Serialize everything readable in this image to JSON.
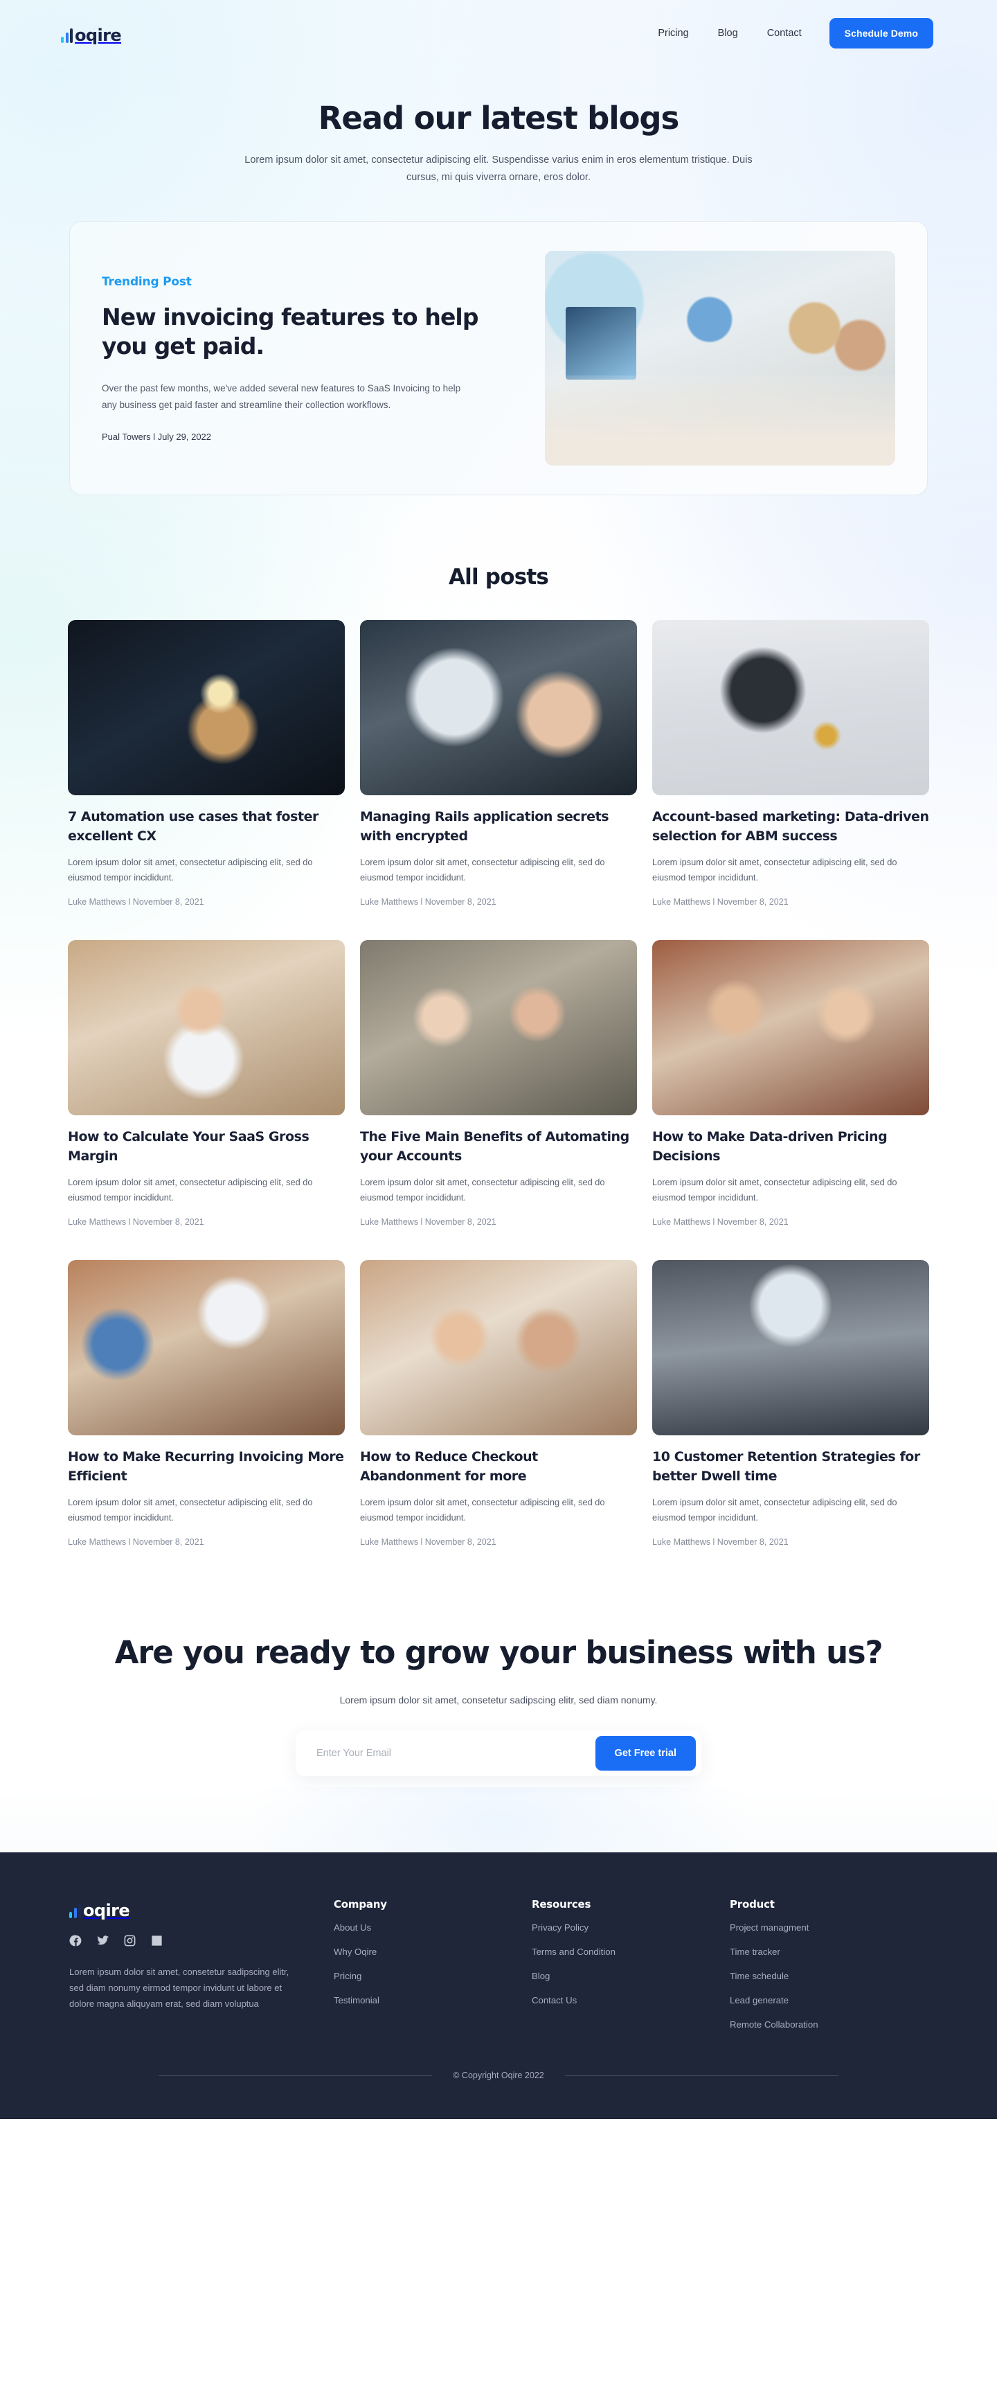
{
  "brand": {
    "name": "oqire",
    "accent": "#1a6ef5",
    "logo_bar_colors": [
      "#22c8f5",
      "#2f7bf6",
      "#1e2a4f"
    ]
  },
  "nav": {
    "links": [
      {
        "label": "Pricing"
      },
      {
        "label": "Blog"
      },
      {
        "label": "Contact"
      }
    ],
    "cta_label": "Schedule Demo"
  },
  "hero": {
    "title": "Read our latest blogs",
    "subtitle": "Lorem ipsum dolor sit amet, consectetur adipiscing elit. Suspendisse varius enim in eros elementum tristique. Duis cursus, mi quis viverra ornare, eros dolor."
  },
  "trending": {
    "tag": "Trending Post",
    "title": "New invoicing features to help you get paid.",
    "description": "Over the past few months, we've added several new features to SaaS Invoicing to help any business get paid faster and streamline their collection workflows.",
    "meta": "Pual Towers l  July 29, 2022",
    "image_alt": "office-team-at-desks-photo"
  },
  "all_posts": {
    "heading": "All posts",
    "posts": [
      {
        "title": "7 Automation use cases that foster excellent CX",
        "excerpt": "Lorem ipsum dolor sit amet, consectetur adipiscing elit, sed do eiusmod tempor incididunt.",
        "meta": "Luke Matthews l  November 8, 2021",
        "image_alt": "hands-holding-lightbulb"
      },
      {
        "title": "Managing Rails application secrets with encrypted",
        "excerpt": "Lorem ipsum dolor sit amet, consectetur adipiscing elit, sed do eiusmod tempor incididunt.",
        "meta": "Luke Matthews l  November 8, 2021",
        "image_alt": "hand-pointing-at-laptop"
      },
      {
        "title": "Account-based marketing: Data-driven selection for ABM success",
        "excerpt": "Lorem ipsum dolor sit amet, consectetur adipiscing elit, sed do eiusmod tempor incididunt.",
        "meta": "Luke Matthews l  November 8, 2021",
        "image_alt": "desk-with-keyboard-and-notes"
      },
      {
        "title": "How to Calculate Your SaaS Gross Margin",
        "excerpt": "Lorem ipsum dolor sit amet, consectetur adipiscing elit, sed do eiusmod tempor incididunt.",
        "meta": "Luke Matthews l  November 8, 2021",
        "image_alt": "man-smiling-at-desk"
      },
      {
        "title": "The Five Main Benefits of Automating your Accounts",
        "excerpt": "Lorem ipsum dolor sit amet, consectetur adipiscing elit, sed do eiusmod tempor incididunt.",
        "meta": "Luke Matthews l  November 8, 2021",
        "image_alt": "three-women-with-laptops"
      },
      {
        "title": "How to Make Data-driven Pricing Decisions",
        "excerpt": "Lorem ipsum dolor sit amet, consectetur adipiscing elit, sed do eiusmod tempor incididunt.",
        "meta": "Luke Matthews l  November 8, 2021",
        "image_alt": "colleagues-high-five"
      },
      {
        "title": "How to Make Recurring Invoicing More Efficient",
        "excerpt": "Lorem ipsum dolor sit amet, consectetur adipiscing elit, sed do eiusmod tempor incididunt.",
        "meta": "Luke Matthews l  November 8, 2021",
        "image_alt": "speaker-presenting-to-audience"
      },
      {
        "title": "How to Reduce Checkout Abandonment for more",
        "excerpt": "Lorem ipsum dolor sit amet, consectetur adipiscing elit, sed do eiusmod tempor incididunt.",
        "meta": "Luke Matthews l  November 8, 2021",
        "image_alt": "two-men-in-meeting"
      },
      {
        "title": "10 Customer Retention Strategies for better Dwell time",
        "excerpt": "Lorem ipsum dolor sit amet, consectetur adipiscing elit, sed do eiusmod tempor incididunt.",
        "meta": "Luke Matthews l  November 8, 2021",
        "image_alt": "conference-room-audience"
      }
    ]
  },
  "cta": {
    "title": "Are you ready to grow your business with us?",
    "subtitle": "Lorem ipsum dolor sit amet, consetetur sadipscing elitr, sed diam nonumy.",
    "email_placeholder": "Enter Your Email",
    "email_value": "",
    "button_label": "Get Free trial"
  },
  "footer": {
    "about": "Lorem ipsum dolor sit amet, consetetur sadipscing elitr, sed diam nonumy eirmod tempor invidunt ut labore et dolore magna aliquyam erat, sed diam voluptua",
    "social": [
      {
        "name": "facebook-icon"
      },
      {
        "name": "twitter-icon"
      },
      {
        "name": "instagram-icon"
      },
      {
        "name": "linkedin-icon"
      }
    ],
    "columns": [
      {
        "heading": "Company",
        "links": [
          {
            "label": "About Us"
          },
          {
            "label": "Why Oqire"
          },
          {
            "label": "Pricing"
          },
          {
            "label": "Testimonial"
          }
        ]
      },
      {
        "heading": "Resources",
        "links": [
          {
            "label": "Privacy Policy"
          },
          {
            "label": "Terms and Condition"
          },
          {
            "label": "Blog"
          },
          {
            "label": "Contact Us"
          }
        ]
      },
      {
        "heading": "Product",
        "links": [
          {
            "label": "Project managment"
          },
          {
            "label": "Time tracker"
          },
          {
            "label": "Time schedule"
          },
          {
            "label": "Lead generate"
          },
          {
            "label": "Remote Collaboration"
          }
        ]
      }
    ],
    "copyright": "© Copyright Oqire 2022"
  }
}
